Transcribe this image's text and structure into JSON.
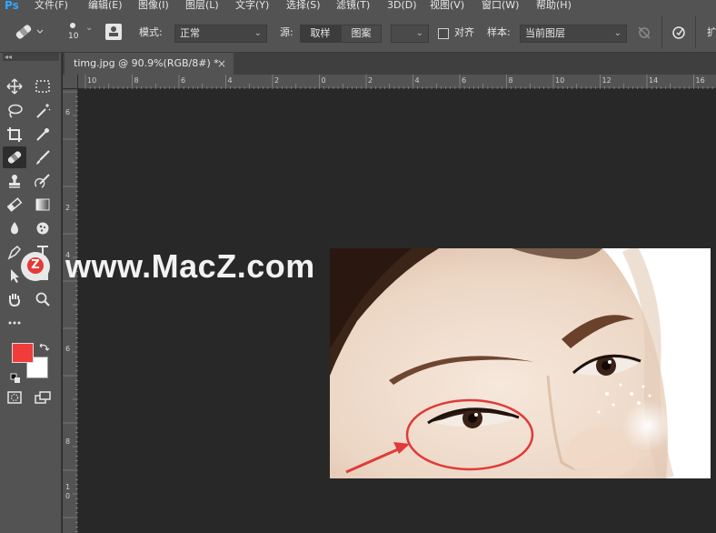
{
  "app": {
    "logo": "Ps"
  },
  "menu": [
    "文件(F)",
    "编辑(E)",
    "图像(I)",
    "图层(L)",
    "文字(Y)",
    "选择(S)",
    "滤镜(T)",
    "3D(D)",
    "视图(V)",
    "窗口(W)",
    "帮助(H)"
  ],
  "options": {
    "brush_size": "10",
    "mode_label": "模式:",
    "mode_value": "正常",
    "source_label": "源:",
    "source_sample": "取样",
    "source_pattern": "图案",
    "align_label": "对齐",
    "sample_label": "样本:",
    "sample_value": "当前图层",
    "trailing": "扩"
  },
  "document": {
    "tab_title": "timg.jpg @ 90.9%(RGB/8#) *",
    "close": "×"
  },
  "rulers": {
    "h": [
      "10",
      "8",
      "6",
      "4",
      "2",
      "0",
      "2",
      "4",
      "6",
      "8",
      "10",
      "12",
      "14",
      "16"
    ],
    "v": [
      "6",
      "2",
      "4",
      "6",
      "8",
      "1",
      "0"
    ]
  },
  "colors": {
    "foreground": "#f23c3c",
    "background": "#ffffff"
  },
  "watermark": {
    "badge": "Z",
    "text": "www.MacZ.com"
  },
  "panel": {
    "collapse": "◂◂"
  }
}
